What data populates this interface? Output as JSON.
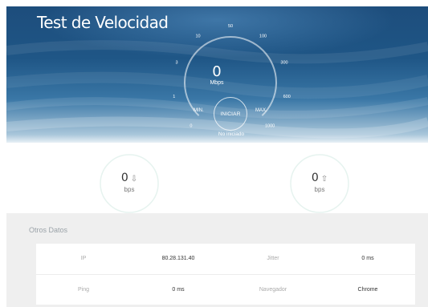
{
  "header": {
    "title": "Test de Velocidad"
  },
  "gauge": {
    "value": "0",
    "unit": "Mbps",
    "scale_labels": [
      "0",
      "1",
      "3",
      "10",
      "50",
      "100",
      "300",
      "600",
      "1000"
    ],
    "min_label": "MIN.",
    "max_label": "MAX.",
    "start_button": "INICIAR",
    "status": "No iniciado"
  },
  "results": {
    "download": {
      "value": "0",
      "unit": "bps",
      "icon": "download-arrow-icon"
    },
    "upload": {
      "value": "0",
      "unit": "bps",
      "icon": "upload-arrow-icon"
    }
  },
  "other_data": {
    "title": "Otros Datos",
    "rows": [
      [
        {
          "key": "IP",
          "value": "80.28.131.40"
        },
        {
          "key": "Jitter",
          "value": "0 ms"
        }
      ],
      [
        {
          "key": "Ping",
          "value": "0 ms"
        },
        {
          "key": "Navegador",
          "value": "Chrome"
        }
      ]
    ]
  },
  "colors": {
    "hero_top": "#1d4d7c",
    "hero_bottom": "#a9c6da",
    "gauge_track": "#ffffff",
    "ring": "#e6f3ef",
    "panel_bg": "#efefef"
  }
}
